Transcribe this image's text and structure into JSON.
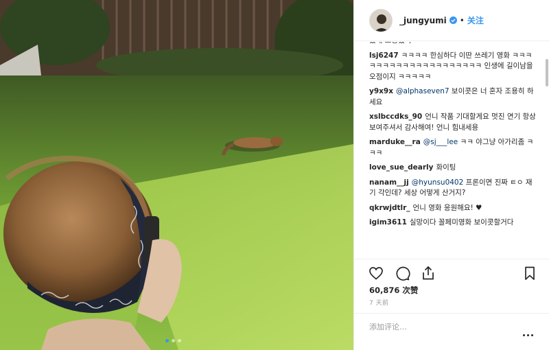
{
  "post": {
    "photo_alt": "",
    "carousel_dots": 3,
    "carousel_active": 0
  },
  "header": {
    "username": "_jungyumi",
    "verified": true,
    "separator": "•",
    "follow_label": "关注",
    "accent_color": "#3897f0"
  },
  "comments": [
    {
      "user": "",
      "mention": "",
      "text": "았네 꼬랑했니ㅋㅋㅋㅋㅋㅋㅋㅋㅋㅋㅋㅋ",
      "cut": true
    },
    {
      "user": "lsj6247",
      "mention": "",
      "text": "ㅋㅋㅋㅋ 한심하다 이딴 쓰레기 영화 ㅋㅋㅋㅋㅋㅋㅋㅋㅋㅋㅋㅋㅋㅋㅋㅋㅋㅋㅋㅋ 인생에 길이남을 오점이지 ㅋㅋㅋㅋㅋ"
    },
    {
      "user": "y9x9x",
      "mention": "@alphaseven7",
      "text": "보이콧은 너 혼자 조용히 하세요"
    },
    {
      "user": "xslbccdks_90",
      "mention": "",
      "text": "언니 작품 기대할게요 멋진 연기 항상 보여주셔서 감사해여! 언니 힘내세용"
    },
    {
      "user": "marduke__ra",
      "mention": "@sj___lee",
      "text": "ㅋㅋ 야그냥 아가리좀 ㅋㅋㅋ"
    },
    {
      "user": "love_sue_dearly",
      "mention": "",
      "text": "화이팅"
    },
    {
      "user": "nanam__jj",
      "mention": "@hyunsu0402",
      "text": "프론이면 진짜 ㅌㅇ 재기 각인데? 세상 어떻게 산거지?"
    },
    {
      "user": "qkrwjdtlr_",
      "mention": "",
      "text": "언니 영화 응원해요! ♥"
    },
    {
      "user": "igim3611",
      "mention": "",
      "text": "실망이다 꼴페미영화 보이콧할거다"
    }
  ],
  "actions": {
    "like_icon": "heart-icon",
    "comment_icon": "comment-bubble-icon",
    "share_icon": "share-icon",
    "save_icon": "bookmark-icon",
    "likes_text": "60,876 次赞",
    "time_text": "7 天前"
  },
  "comment_box": {
    "placeholder": "添加评论…",
    "more_icon": "more-options-icon"
  }
}
